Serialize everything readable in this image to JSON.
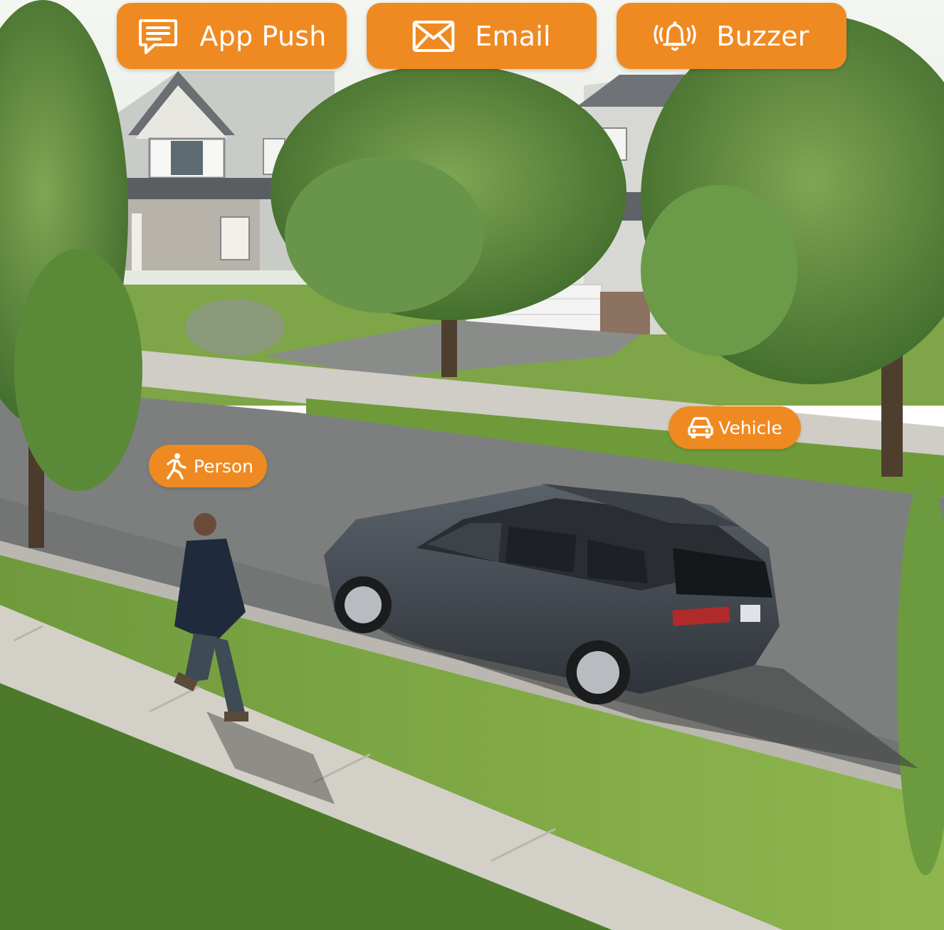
{
  "alerts": {
    "app_push": {
      "label": "App Push",
      "icon": "chat-message-icon"
    },
    "email": {
      "label": "Email",
      "icon": "envelope-icon"
    },
    "buzzer": {
      "label": "Buzzer",
      "icon": "ringing-bell-icon"
    }
  },
  "detections": {
    "person": {
      "label": "Person",
      "icon": "walking-person-icon"
    },
    "vehicle": {
      "label": "Vehicle",
      "icon": "car-icon"
    }
  },
  "colors": {
    "accent": "#ef8a22",
    "text_on_accent": "#ffffff"
  }
}
